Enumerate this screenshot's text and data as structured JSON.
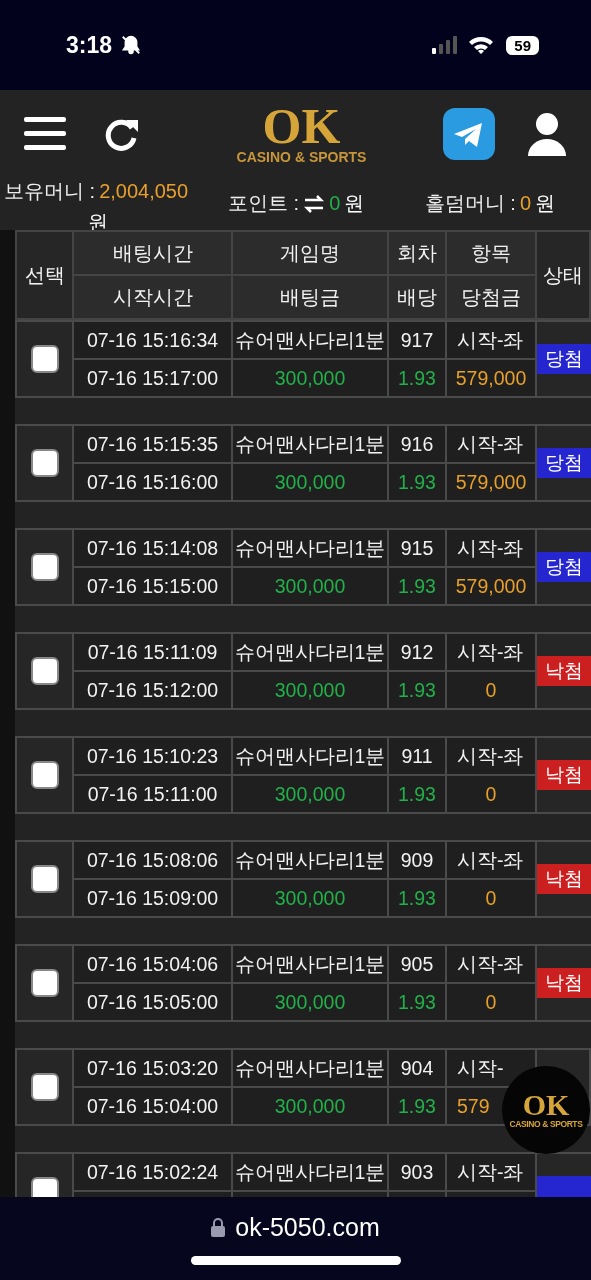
{
  "status_bar": {
    "time": "3:18",
    "battery": "59"
  },
  "header": {
    "logo_main": "OK",
    "logo_sub": "CASINO & SPORTS"
  },
  "balances": [
    {
      "label": "보유머니 :",
      "value": "2,004,050",
      "unit": "원",
      "color": "#e8a02a"
    },
    {
      "label": "포인트 :",
      "value": "0",
      "unit": "원",
      "color": "#22b04a",
      "exchange": true
    },
    {
      "label": "홀덤머니 :",
      "value": "0",
      "unit": "원",
      "color": "#e8a02a"
    }
  ],
  "columns": {
    "select": "선택",
    "top": [
      "배팅시간",
      "게임명",
      "회차",
      "항목"
    ],
    "bottom": [
      "시작시간",
      "배팅금",
      "배당",
      "당첨금"
    ],
    "status": "상태"
  },
  "rows": [
    {
      "checked": false,
      "bet_time": "07-16 15:16:34",
      "game": "슈어맨사다리1분",
      "round": "917",
      "item": "시작-좌",
      "start_time": "07-16 15:17:00",
      "amount": "300,000",
      "odds": "1.93",
      "payout": "579,000",
      "status": {
        "label": "당첨",
        "kind": "win"
      }
    },
    {
      "checked": false,
      "bet_time": "07-16 15:15:35",
      "game": "슈어맨사다리1분",
      "round": "916",
      "item": "시작-좌",
      "start_time": "07-16 15:16:00",
      "amount": "300,000",
      "odds": "1.93",
      "payout": "579,000",
      "status": {
        "label": "당첨",
        "kind": "win"
      }
    },
    {
      "checked": false,
      "bet_time": "07-16 15:14:08",
      "game": "슈어맨사다리1분",
      "round": "915",
      "item": "시작-좌",
      "start_time": "07-16 15:15:00",
      "amount": "300,000",
      "odds": "1.93",
      "payout": "579,000",
      "status": {
        "label": "당첨",
        "kind": "win"
      }
    },
    {
      "checked": false,
      "bet_time": "07-16 15:11:09",
      "game": "슈어맨사다리1분",
      "round": "912",
      "item": "시작-좌",
      "start_time": "07-16 15:12:00",
      "amount": "300,000",
      "odds": "1.93",
      "payout": "0",
      "status": {
        "label": "낙첨",
        "kind": "lose"
      }
    },
    {
      "checked": false,
      "bet_time": "07-16 15:10:23",
      "game": "슈어맨사다리1분",
      "round": "911",
      "item": "시작-좌",
      "start_time": "07-16 15:11:00",
      "amount": "300,000",
      "odds": "1.93",
      "payout": "0",
      "status": {
        "label": "낙첨",
        "kind": "lose"
      }
    },
    {
      "checked": false,
      "bet_time": "07-16 15:08:06",
      "game": "슈어맨사다리1분",
      "round": "909",
      "item": "시작-좌",
      "start_time": "07-16 15:09:00",
      "amount": "300,000",
      "odds": "1.93",
      "payout": "0",
      "status": {
        "label": "낙첨",
        "kind": "lose"
      }
    },
    {
      "checked": false,
      "bet_time": "07-16 15:04:06",
      "game": "슈어맨사다리1분",
      "round": "905",
      "item": "시작-좌",
      "start_time": "07-16 15:05:00",
      "amount": "300,000",
      "odds": "1.93",
      "payout": "0",
      "status": {
        "label": "낙첨",
        "kind": "lose"
      }
    },
    {
      "checked": false,
      "bet_time": "07-16 15:03:20",
      "game": "슈어맨사다리1분",
      "round": "904",
      "item": "시작-",
      "start_time": "07-16 15:04:00",
      "amount": "300,000",
      "odds": "1.93",
      "payout": "579"
    },
    {
      "checked": false,
      "bet_time": "07-16 15:02:24",
      "game": "슈어맨사다리1분",
      "round": "903",
      "item": "시작-좌",
      "status": {
        "kind": "win"
      }
    }
  ],
  "float_logo": {
    "main": "OK",
    "sub": "CASINO & SPORTS"
  },
  "browser_bar": {
    "url": "ok-5050.com"
  }
}
